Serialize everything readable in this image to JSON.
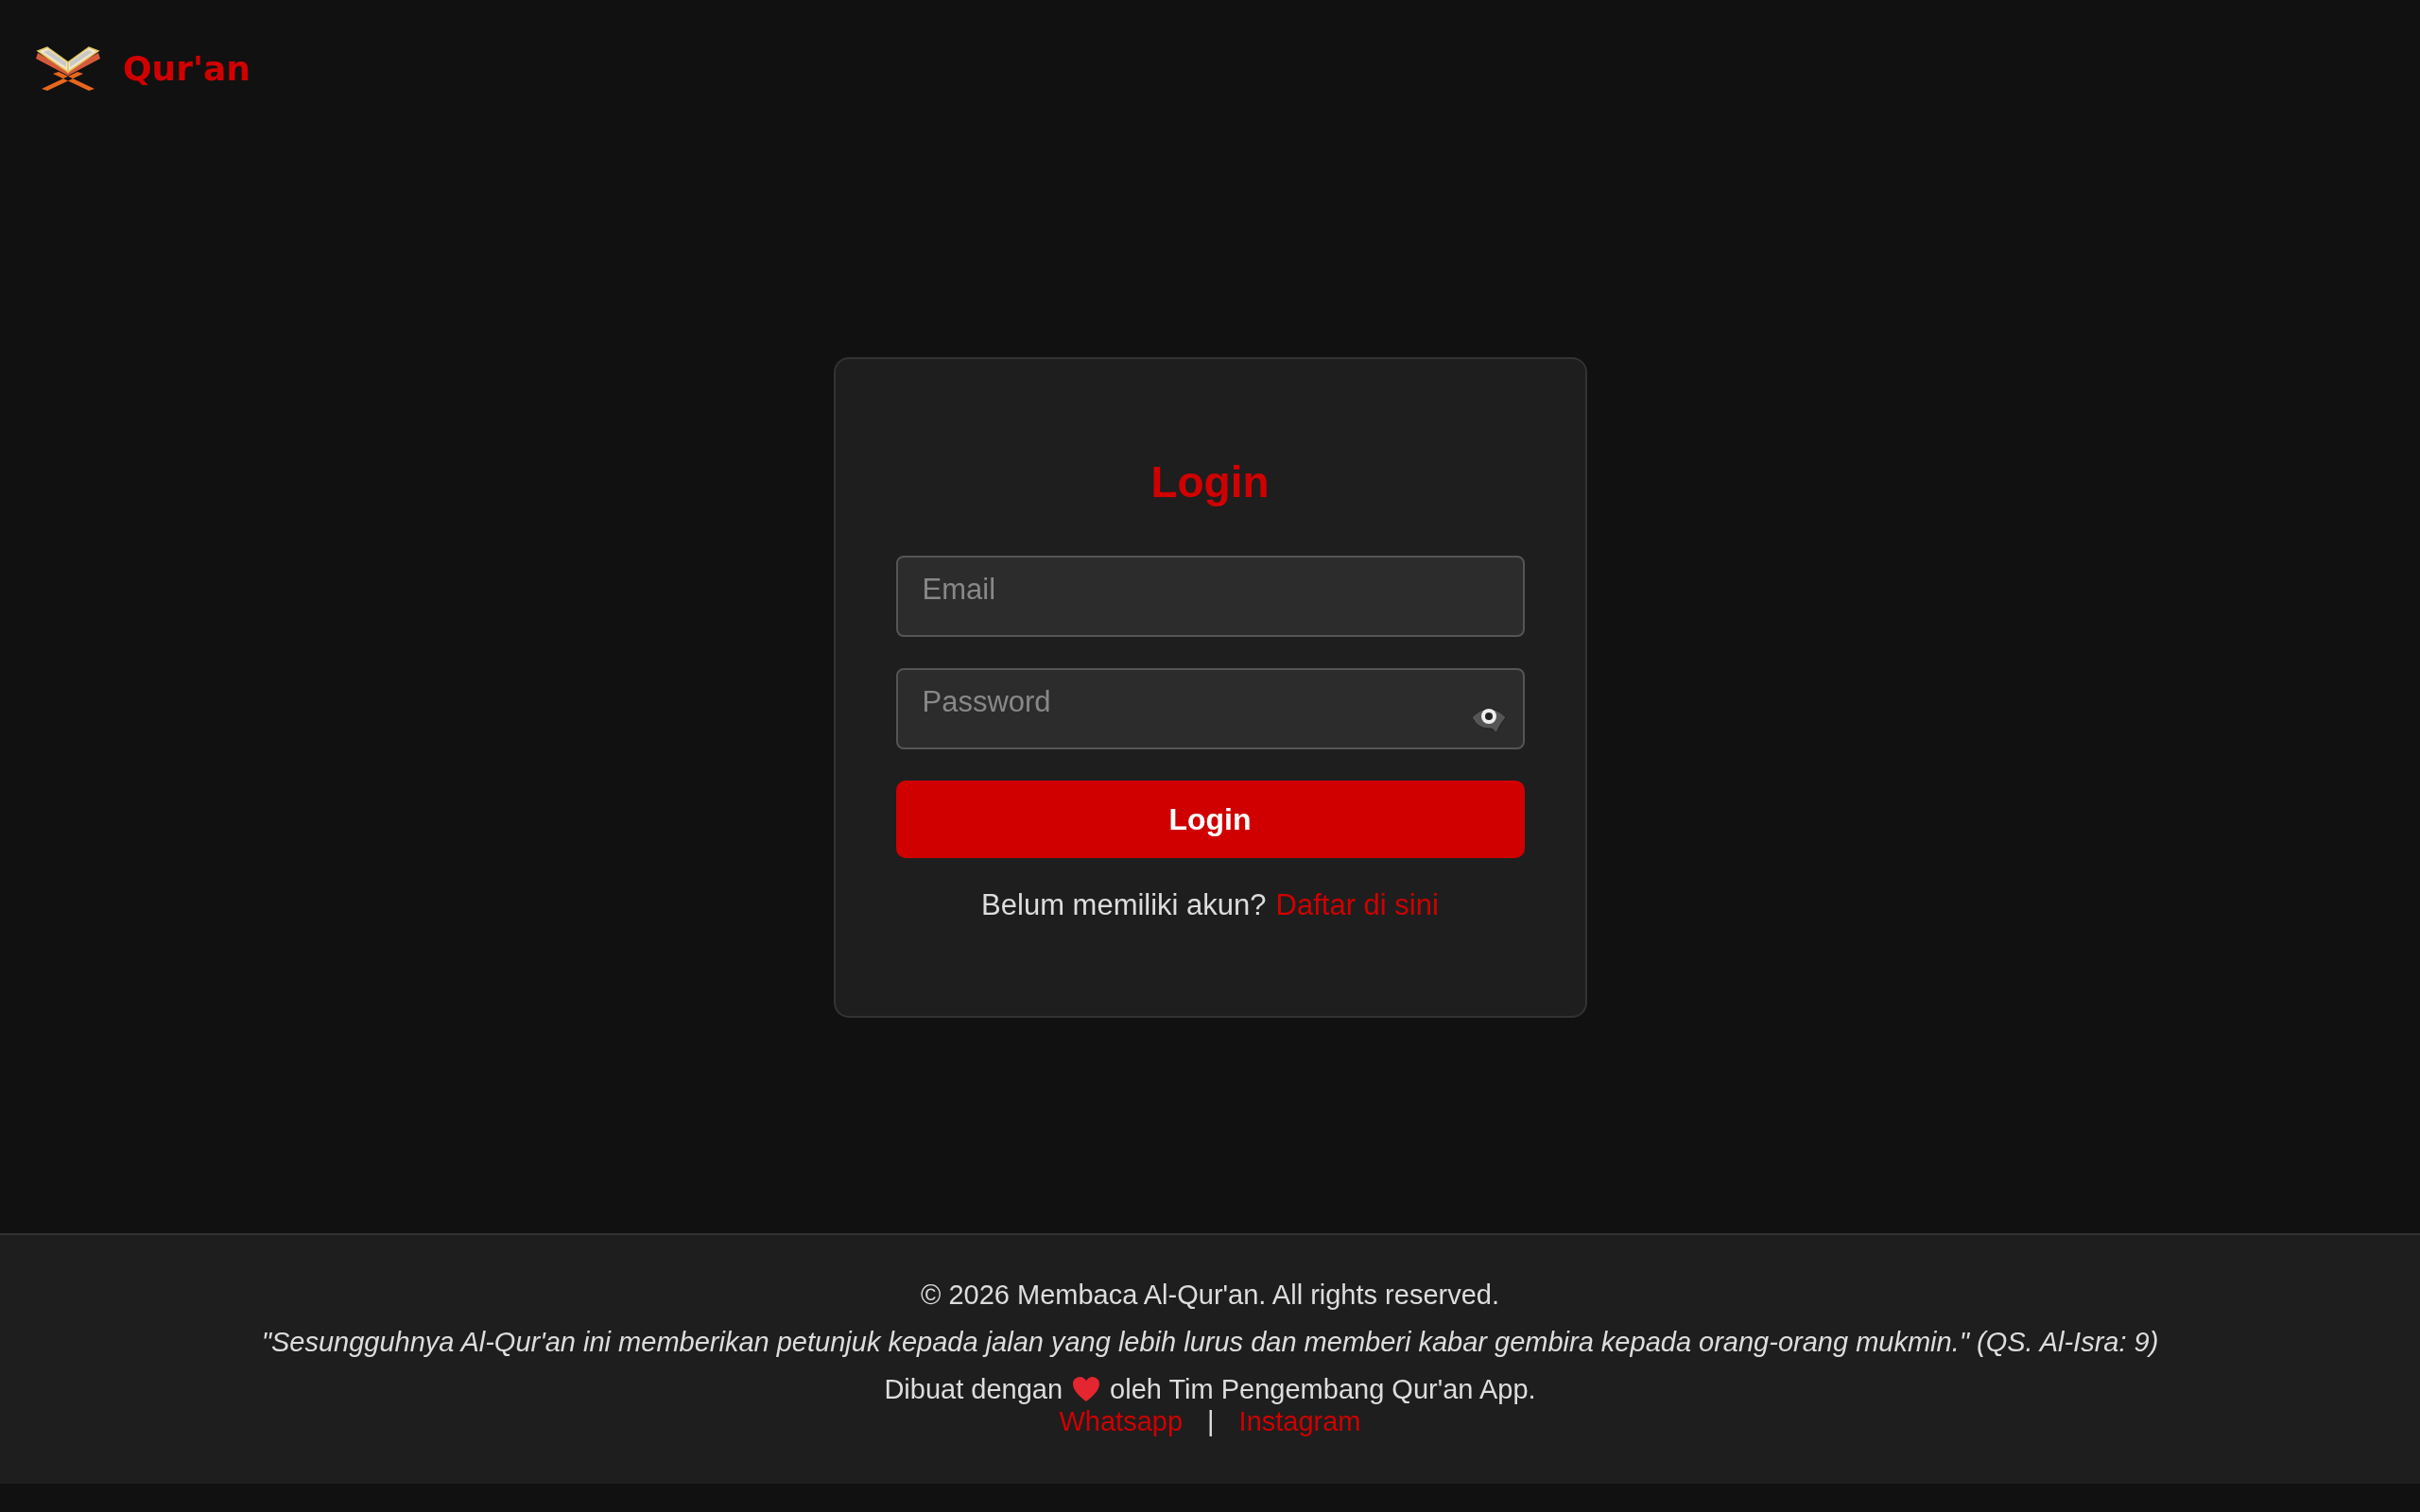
{
  "header": {
    "brand": "Qur'an"
  },
  "login": {
    "title": "Login",
    "fields": [
      {
        "kind": "email",
        "placeholder": "Email"
      },
      {
        "kind": "password",
        "placeholder": "Password"
      }
    ],
    "button": "Login",
    "signup_prompt": "Belum memiliki akun?",
    "signup_link": "Daftar di sini"
  },
  "footer": {
    "copyright": "© 2026 Membaca Al-Qur'an. All rights reserved.",
    "quote": "\"Sesungguhnya Al-Qur'an ini memberikan petunjuk kepada jalan yang lebih lurus dan memberi kabar gembira kepada orang-orang mukmin.\" (QS. Al-Isra: 9)",
    "credit_before": "Dibuat dengan",
    "credit_after": "oleh Tim Pengembang Qur'an App.",
    "links": [
      "Whatsapp",
      "Instagram"
    ],
    "separator": "|"
  }
}
